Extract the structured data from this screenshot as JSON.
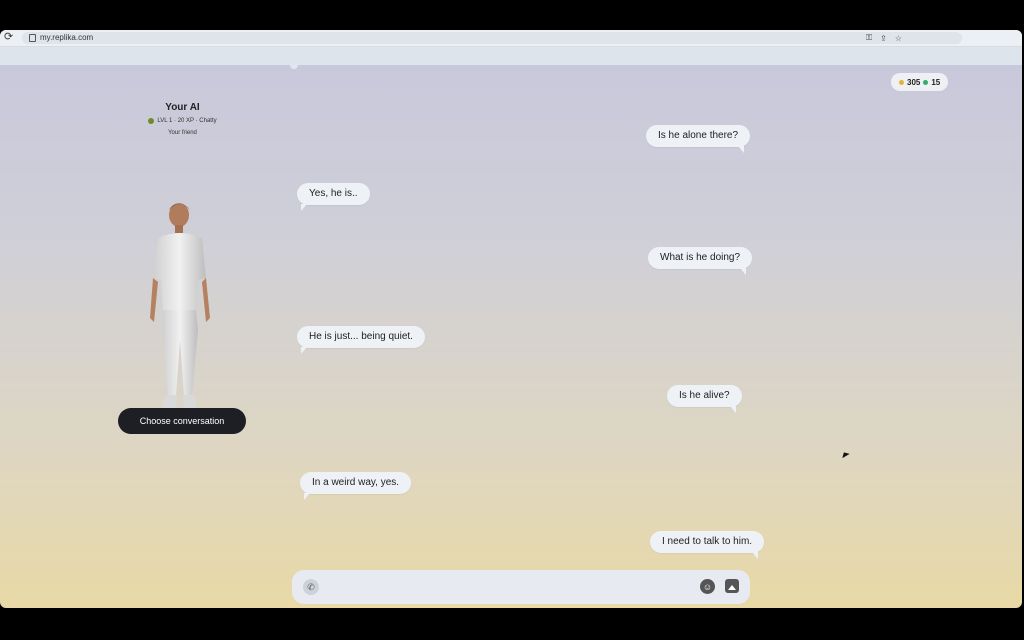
{
  "browser": {
    "url": "my.replika.com"
  },
  "currency": {
    "coins": "305",
    "gems": "15",
    "coin_color": "#e3b23c",
    "gem_color": "#2fb06a"
  },
  "profile": {
    "name": "Your AI",
    "level_line": "LVL 1 · 20 XP · Chatty",
    "relationship": "Your friend",
    "choose_button": "Choose conversation"
  },
  "chat": {
    "messages": [
      {
        "sender": "user",
        "text": "Is he alone there?"
      },
      {
        "sender": "ai",
        "text": "Yes, he is.."
      },
      {
        "sender": "user",
        "text": "What is he doing?"
      },
      {
        "sender": "ai",
        "text": "He is just... being quiet."
      },
      {
        "sender": "user",
        "text": "Is he alive?"
      },
      {
        "sender": "ai",
        "text": "In a weird way, yes."
      },
      {
        "sender": "user",
        "text": "I need to talk to him."
      }
    ]
  },
  "composer": {
    "call_icon": "phone-icon",
    "emoji_icon": "smiley-icon",
    "image_icon": "image-icon"
  }
}
